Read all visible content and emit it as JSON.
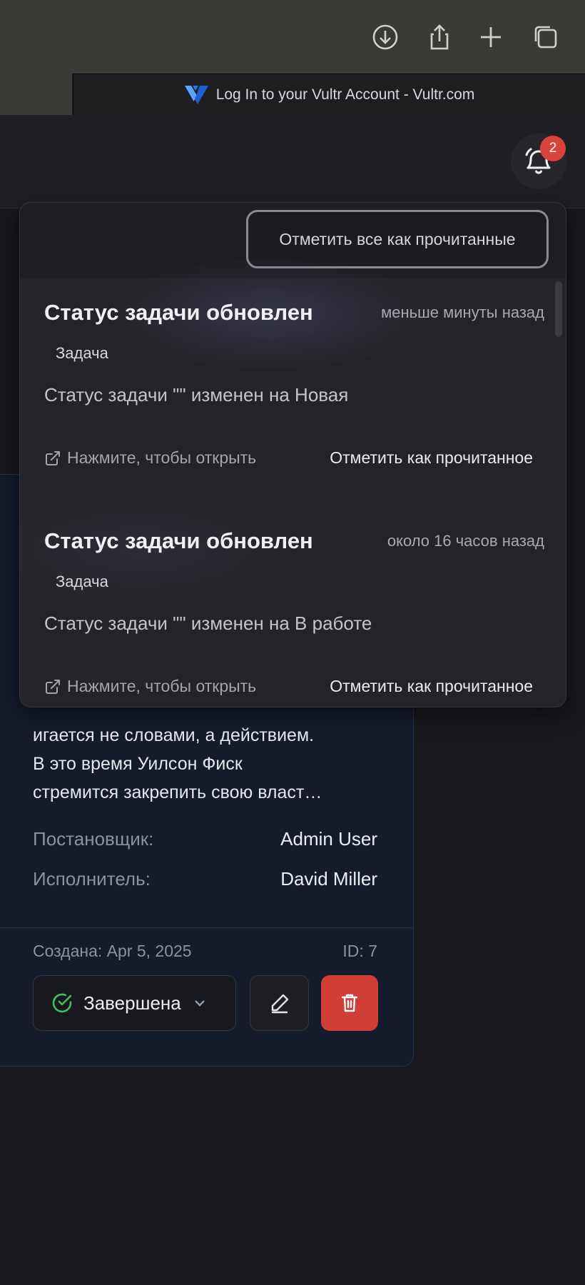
{
  "browser": {
    "tab_title": "Log In to your Vultr Account - Vultr.com",
    "toolbar_icons": [
      "download-icon",
      "share-icon",
      "plus-icon",
      "tabs-icon"
    ]
  },
  "header": {
    "notification_count": "2"
  },
  "notifications": {
    "mark_all_label": "Отметить все как прочитанные",
    "items": [
      {
        "title": "Статус задачи обновлен",
        "time": "меньше минуты назад",
        "tag": "Задача",
        "text": "Статус задачи \"\" изменен на Новая",
        "open_label": "Нажмите, чтобы открыть",
        "mark_label": "Отметить как прочитанное"
      },
      {
        "title": "Статус задачи обновлен",
        "time": "около 16 часов назад",
        "tag": "Задача",
        "text": "Статус задачи \"\" изменен на В работе",
        "open_label": "Нажмите, чтобы открыть",
        "mark_label": "Отметить как прочитанное"
      }
    ]
  },
  "task_card": {
    "description_lines": [
      "игается не словами, а действием.",
      "В это время Уилсон Фиск",
      "стремится закрепить свою власт…"
    ],
    "reporter_label": "Постановщик:",
    "reporter": "Admin User",
    "assignee_label": "Исполнитель:",
    "assignee": "David Miller",
    "created": "Создана: Apr 5, 2025",
    "id": "ID: 7",
    "status": "Завершена",
    "colors": {
      "delete": "#d13e35",
      "status_check": "#3fbf5b",
      "badge": "#d8433a"
    }
  }
}
